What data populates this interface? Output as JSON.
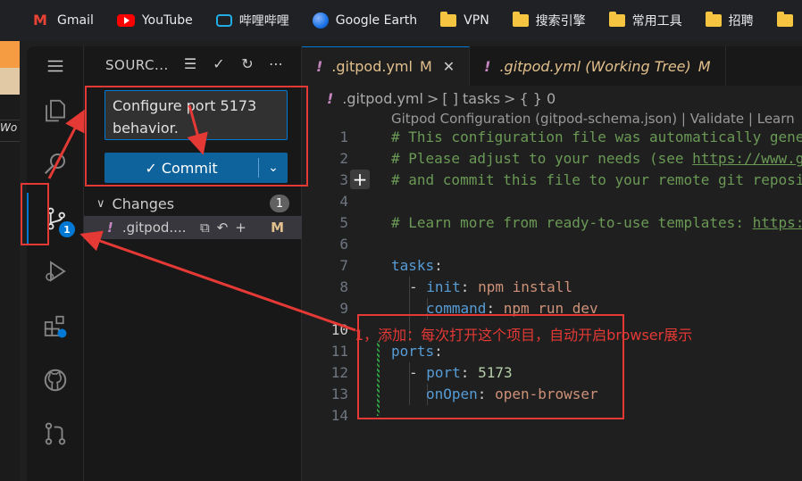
{
  "bookmarks": [
    {
      "label": "Gmail",
      "icon": "gmail-icon"
    },
    {
      "label": "YouTube",
      "icon": "youtube-icon"
    },
    {
      "label": "哔哩哔哩",
      "icon": "bilibili-icon"
    },
    {
      "label": "Google Earth",
      "icon": "google-earth-icon"
    },
    {
      "label": "VPN",
      "icon": "folder-icon"
    },
    {
      "label": "搜索引擎",
      "icon": "folder-icon"
    },
    {
      "label": "常用工具",
      "icon": "folder-icon"
    },
    {
      "label": "招聘",
      "icon": "folder-icon"
    },
    {
      "label": "",
      "icon": "folder-icon"
    }
  ],
  "left_window": {
    "text": "Wo"
  },
  "activity_bar": {
    "scm_badge": "1"
  },
  "sidebar": {
    "title": "SOURC...",
    "commit_message": "Configure port 5173 behavior.",
    "commit_label": "✓ Commit",
    "changes_label": "Changes",
    "changes_count": "1",
    "file": {
      "name": ".gitpod....",
      "status": "M"
    }
  },
  "editor": {
    "tabs": [
      {
        "label": ".gitpod.yml",
        "status": "M"
      },
      {
        "label": ".gitpod.yml (Working Tree)",
        "status": "M"
      }
    ],
    "breadcrumb": {
      "file": ".gitpod.yml",
      "sep1": ">",
      "node1": "[ ] tasks",
      "sep2": ">",
      "node2": "{ } 0"
    },
    "codelens": "Gitpod Configuration (gitpod-schema.json) | Validate | Learn",
    "lines": [
      {
        "n": "1",
        "comment": "# This configuration file was automatically gene"
      },
      {
        "n": "2",
        "comment": "# Please adjust to your needs (see ",
        "link": "https://www.g"
      },
      {
        "n": "3",
        "comment": "# and commit this file to your remote git reposi"
      },
      {
        "n": "4"
      },
      {
        "n": "5",
        "comment": "# Learn more from ready-to-use templates: ",
        "link": "https:"
      },
      {
        "n": "6"
      },
      {
        "n": "7",
        "key": "tasks",
        "punct": ":"
      },
      {
        "n": "8",
        "dash": "- ",
        "key": "init",
        "punct": ": ",
        "value": "npm install"
      },
      {
        "n": "9",
        "key": "command",
        "punct": ": ",
        "value": "npm run dev"
      },
      {
        "n": "10"
      },
      {
        "n": "11",
        "key": "ports",
        "punct": ":"
      },
      {
        "n": "12",
        "dash": "- ",
        "key": "port",
        "punct": ": ",
        "value": "5173"
      },
      {
        "n": "13",
        "key": "onOpen",
        "punct": ": ",
        "value": "open-browser"
      },
      {
        "n": "14"
      }
    ],
    "plus_button": "+"
  },
  "annotation": {
    "text": "1，添加：每次打开这个项目，自动开启browser展示",
    "color": "#e53935"
  }
}
